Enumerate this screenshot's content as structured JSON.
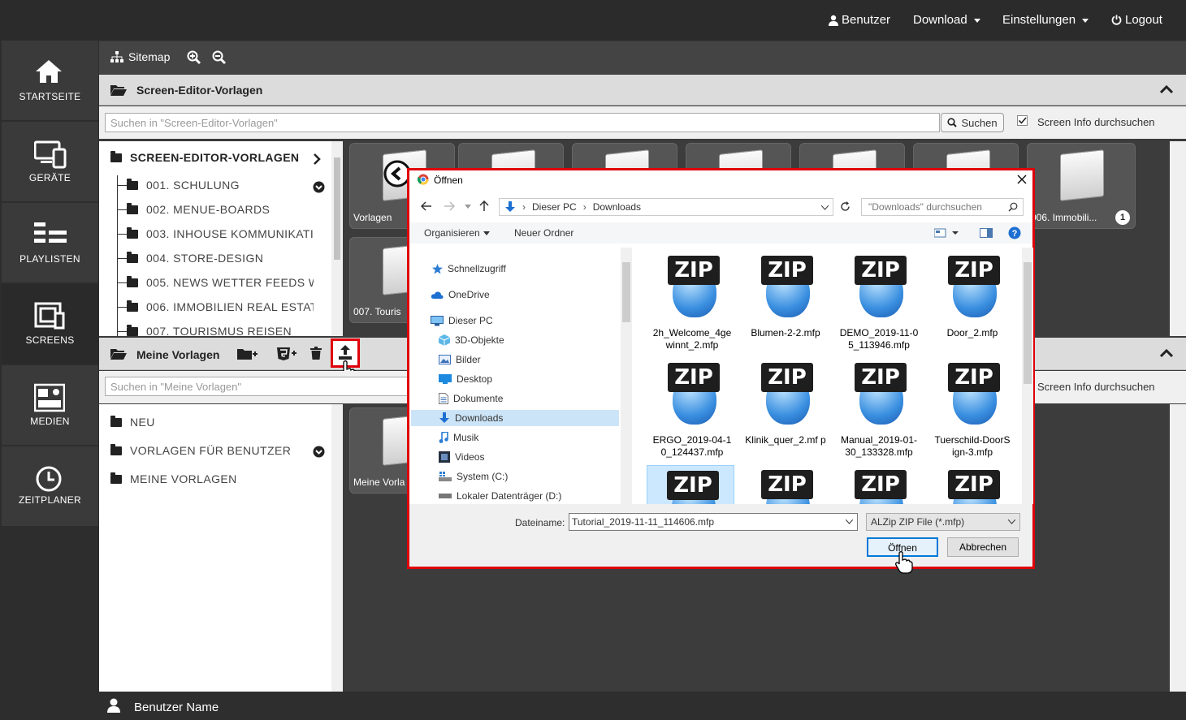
{
  "topbar": {
    "user": "Benutzer",
    "download": "Download",
    "settings": "Einstellungen",
    "logout": "Logout"
  },
  "nav": [
    {
      "label": "STARTSEITE"
    },
    {
      "label": "GERÄTE"
    },
    {
      "label": "PLAYLISTEN"
    },
    {
      "label": "SCREENS"
    },
    {
      "label": "MEDIEN"
    },
    {
      "label": "ZEITPLANER"
    }
  ],
  "toolbar": {
    "sitemap": "Sitemap"
  },
  "panel1": {
    "title": "Screen-Editor-Vorlagen",
    "search_placeholder": "Suchen in \"Screen-Editor-Vorlagen\"",
    "search_button": "Suchen",
    "screen_info": "Screen Info durchsuchen",
    "tree_root": "SCREEN-EDITOR-VORLAGEN",
    "tree_items": [
      "001. SCHULUNG",
      "002. MENUE-BOARDS",
      "003. INHOUSE KOMMUNIKATIC",
      "004. STORE-DESIGN",
      "005. NEWS WETTER FEEDS WE",
      "006. IMMOBILIEN REAL ESTATE",
      "007. TOURISMUS REISEN"
    ],
    "tiles": [
      "Vorlagen",
      "006. Immobili...",
      "007. Touris"
    ],
    "tile_badge": "1"
  },
  "panel2": {
    "title": "Meine Vorlagen",
    "search_placeholder": "Suchen in \"Meine Vorlagen\"",
    "screen_info": "Screen Info durchsuchen",
    "tree_items": [
      "NEU",
      "VORLAGEN FÜR BENUTZER",
      "MEINE VORLAGEN"
    ],
    "tiles": [
      "Meine Vorla"
    ]
  },
  "footer": {
    "user": "Benutzer Name"
  },
  "dialog": {
    "title": "Öffnen",
    "path": [
      "Dieser PC",
      "Downloads"
    ],
    "search_placeholder": "\"Downloads\" durchsuchen",
    "organize": "Organisieren",
    "new_folder": "Neuer Ordner",
    "nav": [
      "Schnellzugriff",
      "OneDrive",
      "Dieser PC",
      "3D-Objekte",
      "Bilder",
      "Desktop",
      "Dokumente",
      "Downloads",
      "Musik",
      "Videos",
      "System (C:)",
      "Lokaler Datenträger (D:)"
    ],
    "files": [
      {
        "name": "2h_Welcome_4ge winnt_2.mfp"
      },
      {
        "name": "Blumen-2-2.mfp"
      },
      {
        "name": "DEMO_2019-11-0 5_113946.mfp"
      },
      {
        "name": "Door_2.mfp"
      },
      {
        "name": "ERGO_2019-04-1 0_124437.mfp"
      },
      {
        "name": "Klinik_quer_2.mf p"
      },
      {
        "name": "Manual_2019-01- 30_133328.mfp"
      },
      {
        "name": "Tuerschild-DoorS ign-3.mfp"
      },
      {
        "name": ""
      },
      {
        "name": ""
      },
      {
        "name": ""
      },
      {
        "name": ""
      }
    ],
    "zip_label": "ZIP",
    "filename_label": "Dateiname:",
    "filename_value": "Tutorial_2019-11-11_114606.mfp",
    "filetype": "ALZip ZIP File (*.mfp)",
    "open": "Öffnen",
    "cancel": "Abbrechen"
  }
}
